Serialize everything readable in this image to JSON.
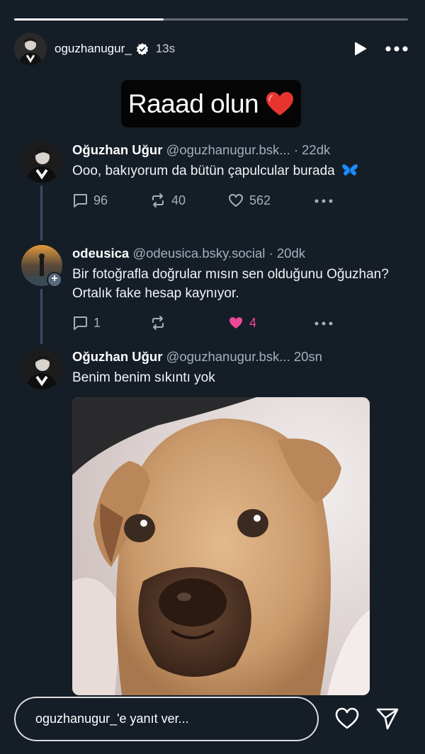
{
  "story": {
    "progress": 0.38,
    "username": "oguzhanugur_",
    "time": "13s",
    "caption": "Raaad olun"
  },
  "posts": [
    {
      "name": "Oğuzhan Uğur",
      "handle": "@oguzhanugur.bsk...",
      "time": "· 22dk",
      "text": "Ooo, bakıyorum da bütün çapulcular burada",
      "replies": "96",
      "reposts": "40",
      "likes": "562"
    },
    {
      "name": "odeusica",
      "handle": "@odeusica.bsky.social",
      "time": "· 20dk",
      "text": "Bir fotoğrafla doğrular mısın sen olduğunu Oğuzhan? Ortalık fake hesap kaynıyor.",
      "replies": "1",
      "reposts": "",
      "likes": "4"
    },
    {
      "name": "Oğuzhan Uğur",
      "handle": "@oguzhanugur.bsk...",
      "time": "20sn",
      "text": "Benim benim sıkıntı yok"
    }
  ],
  "reply": {
    "placeholder": "oguzhanugur_'e yanıt ver..."
  },
  "colors": {
    "background": "#151d27",
    "like_pink": "#ec4899",
    "thread_line": "#3a4f66",
    "butterfly": "#1d8cf8"
  }
}
